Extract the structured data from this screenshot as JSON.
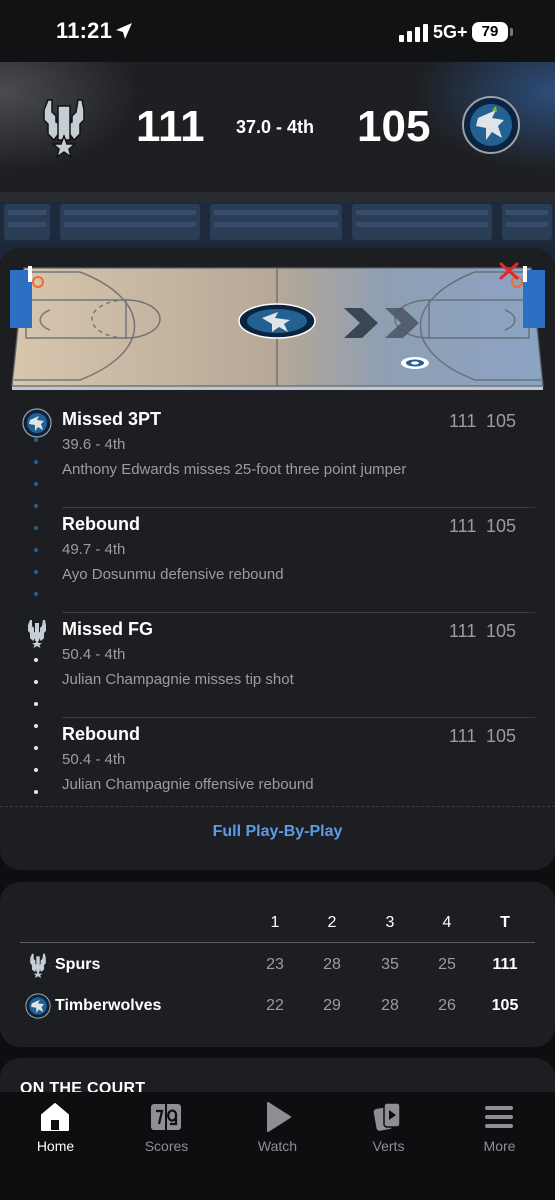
{
  "status": {
    "time": "11:21",
    "network": "5G+",
    "battery": "79"
  },
  "header": {
    "home_score": "111",
    "clock": "37.0 - 4th",
    "away_score": "105",
    "home_logo": "spurs-logo-icon",
    "away_logo": "timberwolves-logo-icon"
  },
  "plays": [
    {
      "title": "Missed 3PT",
      "time": "39.6 - 4th",
      "desc": "Anthony Edwards misses 25-foot three point jumper",
      "home": "111",
      "away": "105",
      "team": "timberwolves"
    },
    {
      "title": "Rebound",
      "time": "49.7 - 4th",
      "desc": "Ayo Dosunmu defensive rebound",
      "home": "111",
      "away": "105",
      "team": "timberwolves"
    },
    {
      "title": "Missed FG",
      "time": "50.4 - 4th",
      "desc": "Julian Champagnie misses tip shot",
      "home": "111",
      "away": "105",
      "team": "spurs"
    },
    {
      "title": "Rebound",
      "time": "50.4 - 4th",
      "desc": "Julian Champagnie offensive rebound",
      "home": "111",
      "away": "105",
      "team": "spurs"
    }
  ],
  "full_pbp_label": "Full Play-By-Play",
  "box_score": {
    "headers": [
      "1",
      "2",
      "3",
      "4",
      "T"
    ],
    "rows": [
      {
        "team": "Spurs",
        "q": [
          "23",
          "28",
          "35",
          "25"
        ],
        "total": "111"
      },
      {
        "team": "Timberwolves",
        "q": [
          "22",
          "29",
          "28",
          "26"
        ],
        "total": "105"
      }
    ]
  },
  "on_the_court_title": "ON THE COURT",
  "tabs": [
    {
      "label": "Home",
      "icon": "home-icon",
      "active": true
    },
    {
      "label": "Scores",
      "icon": "scores-icon",
      "active": false
    },
    {
      "label": "Watch",
      "icon": "play-icon",
      "active": false
    },
    {
      "label": "Verts",
      "icon": "verts-icon",
      "active": false
    },
    {
      "label": "More",
      "icon": "menu-icon",
      "active": false
    }
  ],
  "colors": {
    "accent_link": "#5e9ae8",
    "wolves_blue": "#236192",
    "spurs_gray": "#c4ced4"
  }
}
